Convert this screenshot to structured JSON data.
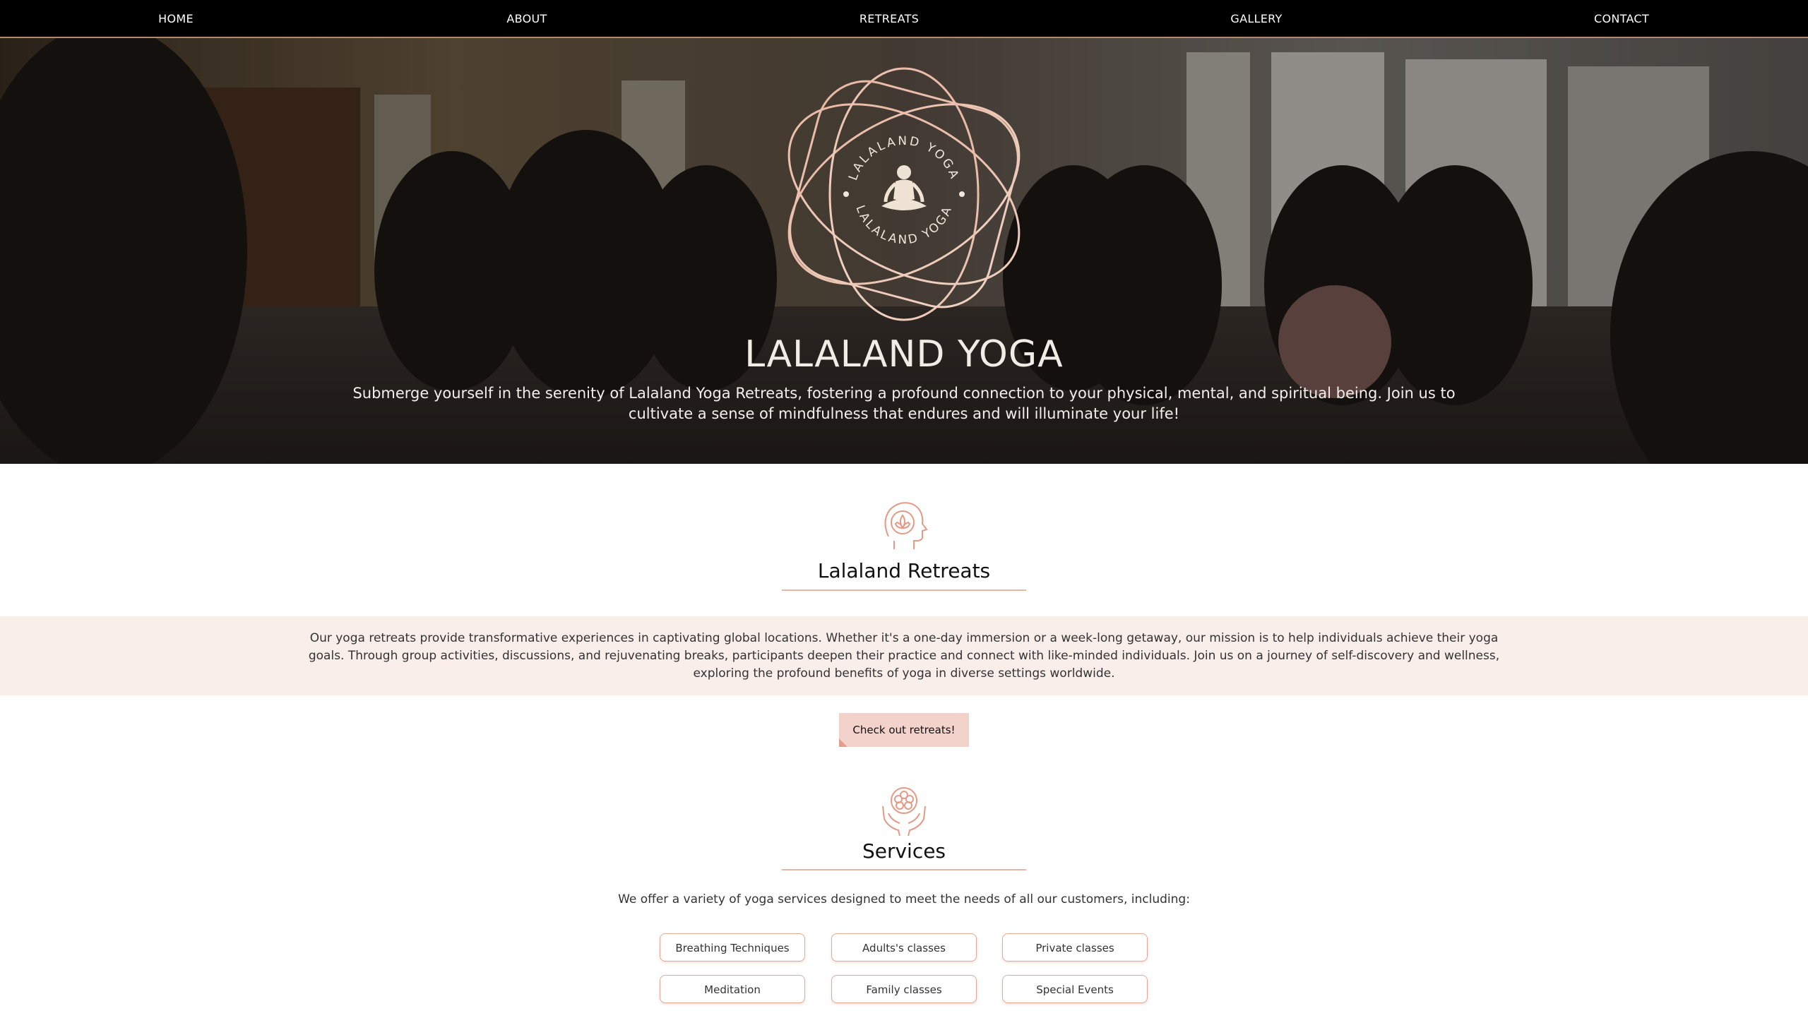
{
  "nav": {
    "home": "HOME",
    "about": "ABOUT",
    "retreats": "RETREATS",
    "gallery": "GALLERY",
    "contact": "CONTACT"
  },
  "hero": {
    "logo_text_top": "LALALAND YOGA",
    "logo_text_bottom": "LALALAND YOGA",
    "title": "LALALAND YOGA",
    "subtitle": "Submerge yourself in the serenity of Lalaland Yoga Retreats, fostering a profound connection to your physical, mental, and spiritual being. Join us to cultivate a sense of mindfulness that endures and will illuminate your life!"
  },
  "retreats": {
    "icon": "lotus-head-icon",
    "title": "Lalaland Retreats",
    "description": "Our yoga retreats provide transformative experiences in captivating global locations. Whether it's a one-day immersion or a week-long getaway, our mission is to help individuals achieve their yoga goals. Through group activities, discussions, and rejuvenating breaks, participants deepen their practice and connect with like-minded individuals. Join us on a journey of self-discovery and wellness, exploring the profound benefits of yoga in diverse settings worldwide.",
    "cta_label": "Check out retreats!"
  },
  "services": {
    "icon": "hands-lotus-icon",
    "title": "Services",
    "intro": "We offer a variety of yoga services designed to meet the needs of all our customers, including:",
    "items": [
      "Breathing Techniques",
      "Adults's classes",
      "Private classes",
      "Meditation",
      "Family classes",
      "Special Events"
    ]
  },
  "colors": {
    "nav_bg": "#000000",
    "accent": "#e8a797",
    "band_bg": "#f9eeea",
    "cta_bg": "#f3d2cb"
  }
}
